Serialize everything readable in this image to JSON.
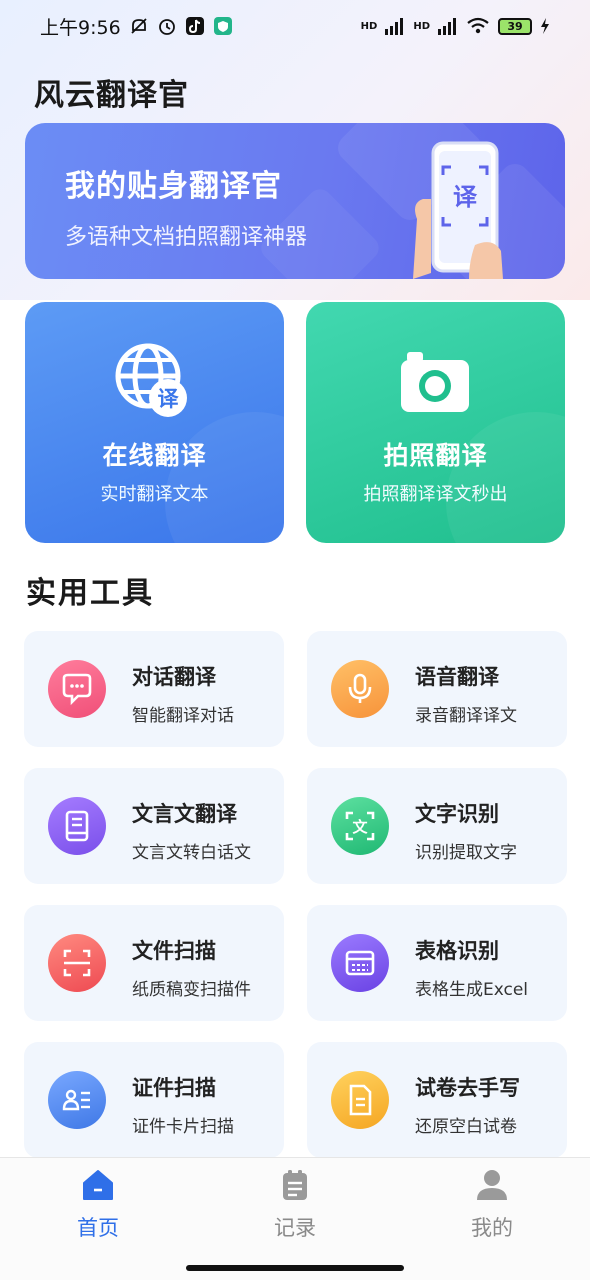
{
  "status_bar": {
    "time": "上午9:56",
    "battery": "39",
    "signal_label_1": "HD",
    "signal_label_2": "HD"
  },
  "app": {
    "title": "风云翻译官"
  },
  "banner": {
    "title": "我的贴身翻译官",
    "subtitle": "多语种文档拍照翻译神器",
    "phone_glyph": "译"
  },
  "feature_cards": [
    {
      "title": "在线翻译",
      "subtitle": "实时翻译文本",
      "icon": "globe-translate-icon",
      "glyph": "译"
    },
    {
      "title": "拍照翻译",
      "subtitle": "拍照翻译译文秒出",
      "icon": "camera-icon"
    }
  ],
  "tools_section": {
    "title": "实用工具",
    "items": [
      {
        "title": "对话翻译",
        "subtitle": "智能翻译对话",
        "icon": "chat-bubble-icon",
        "color": "#f04f78"
      },
      {
        "title": "语音翻译",
        "subtitle": "录音翻译译文",
        "icon": "microphone-icon",
        "color": "#f7a03a"
      },
      {
        "title": "文言文翻译",
        "subtitle": "文言文转白话文",
        "icon": "book-icon",
        "color": "#8a5cf0"
      },
      {
        "title": "文字识别",
        "subtitle": "识别提取文字",
        "icon": "text-scan-icon",
        "color": "#2ec27e",
        "glyph": "文"
      },
      {
        "title": "文件扫描",
        "subtitle": "纸质稿变扫描件",
        "icon": "document-scan-icon",
        "color": "#f0545c"
      },
      {
        "title": "表格识别",
        "subtitle": "表格生成Excel",
        "icon": "table-icon",
        "color": "#7a52ea"
      },
      {
        "title": "证件扫描",
        "subtitle": "证件卡片扫描",
        "icon": "id-card-icon",
        "color": "#4a86ec"
      },
      {
        "title": "试卷去手写",
        "subtitle": "还原空白试卷",
        "icon": "paper-icon",
        "color": "#f6b02c"
      }
    ]
  },
  "bottom_nav": {
    "items": [
      {
        "label": "首页",
        "icon": "home-icon",
        "active": true
      },
      {
        "label": "记录",
        "icon": "clipboard-icon",
        "active": false
      },
      {
        "label": "我的",
        "icon": "user-icon",
        "active": false
      }
    ]
  },
  "colors": {
    "accent": "#2f6fe8",
    "online_card": "#3a76ea",
    "photo_card": "#20bf8e",
    "banner": "#6a79f0"
  }
}
